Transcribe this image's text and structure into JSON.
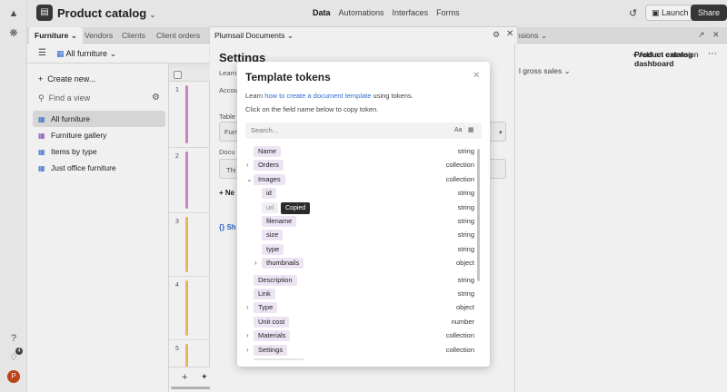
{
  "topbar": {
    "base_title": "Product catalog",
    "nav": [
      "Data",
      "Automations",
      "Interfaces",
      "Forms"
    ],
    "active_nav": "Data",
    "launch_label": "Launch",
    "share_label": "Share"
  },
  "tabs": {
    "items": [
      "Furniture",
      "Vendors",
      "Clients",
      "Client orders"
    ],
    "extensions_fragment": "nsions"
  },
  "viewbar": {
    "current_view": "All furniture"
  },
  "sidebar": {
    "create_label": "Create new...",
    "find_placeholder": "Find a view",
    "views": [
      {
        "label": "All furniture",
        "type": "grid"
      },
      {
        "label": "Furniture gallery",
        "type": "gallery"
      },
      {
        "label": "Items by type",
        "type": "grid"
      },
      {
        "label": "Just office furniture",
        "type": "grid"
      }
    ]
  },
  "grid": {
    "rows": [
      {
        "num": "1",
        "color": "#d98ad2"
      },
      {
        "num": "2",
        "color": "#d98ad2"
      },
      {
        "num": "3",
        "color": "#f0c36a"
      },
      {
        "num": "4",
        "color": "#f0c36a"
      },
      {
        "num": "5",
        "color": "#f0c36a"
      }
    ]
  },
  "settings": {
    "title": "Settings",
    "learn_fragment": "Learn",
    "account_fragment": "Accou",
    "table_fragment": "Table",
    "table_value_fragment": "Furni",
    "document_fragment": "Docu",
    "doc_value_fragment": "Thi",
    "new_fragment": "+ Ne",
    "show_fragment": "{} Sh"
  },
  "plumsail": {
    "title": "Plumsail Documents"
  },
  "extensions": {
    "dashboard_title": "Product catalog dashboard",
    "add_extension": "+ Add an extension",
    "gross_fragment": "l gross sales"
  },
  "modal": {
    "title": "Template tokens",
    "learn_prefix": "Learn ",
    "learn_link": "how to create a document template",
    "learn_suffix": " using tokens.",
    "hint": "Click on the field name below to copy token.",
    "search_placeholder": "Search...",
    "aa": "Aa",
    "tooltip": "Copied",
    "tokens": [
      {
        "label": "Name",
        "type": "string",
        "indent": 0,
        "expand": ""
      },
      {
        "label": "Orders",
        "type": "collection",
        "indent": 0,
        "expand": "right"
      },
      {
        "label": "Images",
        "type": "collection",
        "indent": 0,
        "expand": "down"
      },
      {
        "label": "id",
        "type": "string",
        "indent": 1,
        "expand": ""
      },
      {
        "label": "url",
        "type": "string",
        "indent": 1,
        "expand": "",
        "muted": true
      },
      {
        "label": "filename",
        "type": "string",
        "indent": 1,
        "expand": ""
      },
      {
        "label": "size",
        "type": "string",
        "indent": 1,
        "expand": ""
      },
      {
        "label": "type",
        "type": "string",
        "indent": 1,
        "expand": ""
      },
      {
        "label": "thumbnails",
        "type": "object",
        "indent": 1,
        "expand": "right"
      },
      {
        "label": "Description",
        "type": "string",
        "indent": 0,
        "expand": ""
      },
      {
        "label": "Link",
        "type": "string",
        "indent": 0,
        "expand": ""
      },
      {
        "label": "Type",
        "type": "object",
        "indent": 0,
        "expand": "right"
      },
      {
        "label": "Unit cost",
        "type": "number",
        "indent": 0,
        "expand": ""
      },
      {
        "label": "Materials",
        "type": "collection",
        "indent": 0,
        "expand": "right"
      },
      {
        "label": "Settings",
        "type": "collection",
        "indent": 0,
        "expand": "right"
      }
    ]
  }
}
